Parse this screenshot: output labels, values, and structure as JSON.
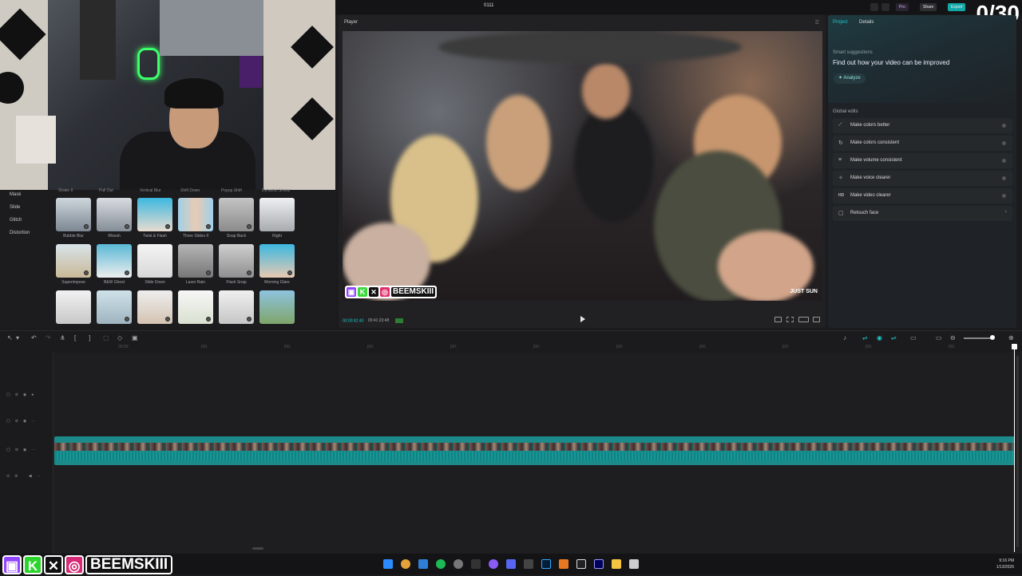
{
  "header": {
    "project_title": "0111",
    "pro_label": "Pro",
    "share_label": "Share",
    "export_label": "Export",
    "counter": "0/30"
  },
  "effects_panel": {
    "categories": [
      "Mask",
      "Slide",
      "Glitch",
      "Distortion"
    ],
    "top_labels": [
      "Shake II",
      "Pull Out",
      "Vertical Blur",
      "Shift Down",
      "Popup Shift",
      "Dynamic Smear"
    ],
    "rows": [
      [
        "Bubble Blur",
        "Woosh",
        "Twist & Flash",
        "Three Slides II",
        "Snap Back",
        "Right"
      ],
      [
        "Superimpose",
        "B&W Ghost",
        "Slide Down",
        "Laser Rain",
        "Flash Snap",
        "Morning Glare"
      ],
      [
        "",
        "",
        "",
        "",
        "",
        ""
      ]
    ]
  },
  "player": {
    "title": "Player",
    "current_time": "00:00:42:40",
    "total_time": "00:41:23:48",
    "overlay_name": "BEEMSKIII",
    "watermark": "JUST SUN"
  },
  "right_panel": {
    "tabs": [
      "Project",
      "Details"
    ],
    "smart_suggestions_title": "Smart suggestions",
    "smart_suggestions_text": "Find out how your video can be improved",
    "analyze_label": "Analyze",
    "global_edits_title": "Global edits",
    "global_edits": [
      {
        "label": "Make colors better",
        "icon": "wand-icon"
      },
      {
        "label": "Make colors consistent",
        "icon": "color-sync-icon"
      },
      {
        "label": "Make volume consistent",
        "icon": "volume-icon"
      },
      {
        "label": "Make voice clearer",
        "icon": "voice-icon"
      },
      {
        "label": "Make video clearer",
        "icon": "hd-icon"
      },
      {
        "label": "Retouch face",
        "icon": "face-icon"
      }
    ]
  },
  "timeline": {
    "ruler_ticks": [
      "00:00",
      "|00:",
      "|00:",
      "|00:",
      "|00:",
      "|00:",
      "|00:",
      "|00:",
      "|00:",
      "|00:",
      "|00:"
    ]
  },
  "taskbar": {
    "time": "9:16 PM",
    "date": "1/13/2026",
    "social_name": "BEEMSKIII"
  },
  "colors": {
    "accent": "#1fc7c7",
    "export_button": "#13a8a8",
    "clip_teal": "#1d8a8a"
  }
}
